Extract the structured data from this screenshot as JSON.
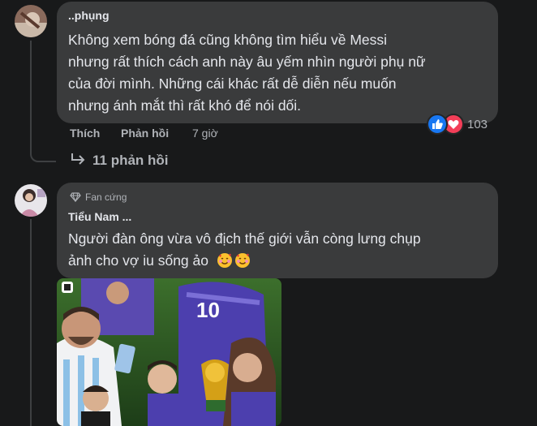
{
  "comment1": {
    "author": "..phụng",
    "lines": [
      "Không xem bóng đá cũng không tìm hiểu về Messi",
      "nhưng rất thích cách anh này âu yếm nhìn người phụ nữ",
      "của đời mình. Những cái khác rất dễ diễn nếu muốn",
      "nhưng ánh mắt thì rất khó để nói dối."
    ],
    "like_label": "Thích",
    "reply_label": "Phản hồi",
    "time": "7 giờ",
    "reaction_icons": [
      "like-icon",
      "love-icon"
    ],
    "reaction_count": "103",
    "replies_label": "11 phản hồi"
  },
  "comment2": {
    "badge": "Fan cứng",
    "author": "Tiểu Nam ...",
    "lines": [
      "Người đàn ông vừa vô địch thế giới vẫn còng lưng chụp",
      "ảnh cho vợ iu sống ảo"
    ],
    "emoji_icons": [
      "smiling-face-with-hearts-icon",
      "smiling-face-with-hearts-icon"
    ],
    "photo_jersey_number": "10"
  },
  "colors": {
    "background": "#18191a",
    "bubble": "#3a3b3c",
    "text": "#e4e6eb",
    "secondary": "#b0b3b8",
    "like_blue": "#1877f2",
    "love_red": "#f33e58"
  }
}
